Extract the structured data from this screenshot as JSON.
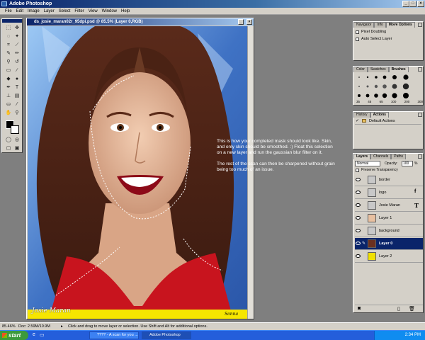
{
  "app": {
    "title": "Adobe Photoshop"
  },
  "menus": [
    "File",
    "Edit",
    "Image",
    "Layer",
    "Select",
    "Filter",
    "View",
    "Window",
    "Help"
  ],
  "document": {
    "title": "ds_josie_maran02r_95dpi.psd @ 85.5% (Layer 0,RGB)",
    "zoom": "85.5%",
    "signature": "Josie Maran",
    "logo": "Sonna"
  },
  "overlay": {
    "paragraph1": "This is how your completed mask should look like. Skin, and only skin should be smoothed. :) Float this selection on a new layer and run the gaussian blur filter on it.",
    "paragraph2": "The rest of the scan can then be sharpened without grain being too much of an issue."
  },
  "navigator": {
    "tabs": [
      "Navigator",
      "Info",
      "Move Options"
    ],
    "options": [
      "Pixel Doubling",
      "Auto Select Layer"
    ]
  },
  "brushes": {
    "tabs": [
      "Color",
      "Swatches",
      "Brushes"
    ],
    "sizes": [
      "35",
      "45",
      "65",
      "100",
      "200",
      "300"
    ]
  },
  "actions": {
    "tabs": [
      "History",
      "Actions"
    ],
    "items": [
      "Default Actions"
    ]
  },
  "layers": {
    "tabs": [
      "Layers",
      "Channels",
      "Paths"
    ],
    "blend_mode": "Normal",
    "opacity_label": "Opacity:",
    "opacity": "100",
    "opacity_unit": "%",
    "preserve": "Preserve Transparency",
    "rows": [
      {
        "name": "border",
        "thumb": "#c8c8c8",
        "icon": ""
      },
      {
        "name": "logo",
        "thumb": "#c8c8c8",
        "icon": "f"
      },
      {
        "name": "Josie Maran",
        "thumb": "#c8c8c8",
        "icon": "T"
      },
      {
        "name": "Layer 1",
        "thumb": "#e8c0a0",
        "icon": ""
      },
      {
        "name": "background",
        "thumb": "#c8c8c8",
        "icon": ""
      },
      {
        "name": "Layer 0",
        "thumb": "#6a3020",
        "icon": ""
      },
      {
        "name": "Layer 2",
        "thumb": "#f0e000",
        "icon": ""
      }
    ]
  },
  "status": {
    "zoom": "85.46%",
    "doc": "Doc: 2.59M/10.9M",
    "hint": "Click and drag to move layer or selection. Use Shift and Alt for additional options."
  },
  "taskbar": {
    "start": "start",
    "buttons": [
      "???? - A scan for you ...",
      "Adobe Photoshop"
    ],
    "time": "2:34 PM"
  },
  "colors": {
    "accent": "#0a246a",
    "taskbar": "#245edb",
    "canvas_bg": "#7f7f7f"
  }
}
